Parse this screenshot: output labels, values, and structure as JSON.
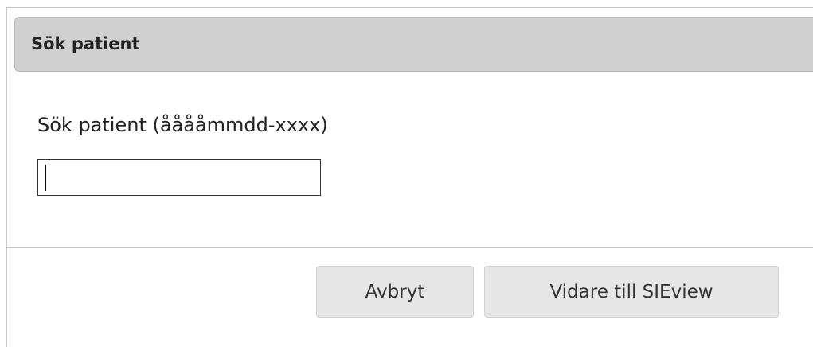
{
  "dialog": {
    "title": "Sök patient",
    "field_label": "Sök patient (ååååmmdd-xxxx)",
    "search_value": "",
    "buttons": {
      "cancel_label": "Avbryt",
      "next_label": "Vidare till SIEview"
    }
  },
  "colors": {
    "titlebar_bg": "#d0d0d0",
    "button_bg": "#e6e6e6",
    "border": "#c8c8c8"
  }
}
